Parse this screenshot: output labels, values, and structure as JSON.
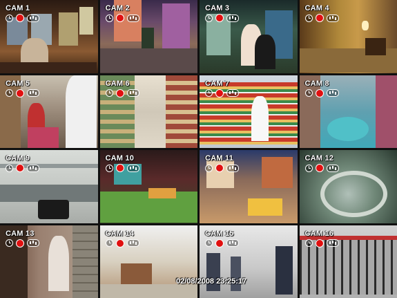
{
  "cameras": [
    {
      "label": "CAM 1"
    },
    {
      "label": "CAM 2"
    },
    {
      "label": "CAM 3"
    },
    {
      "label": "CAM 4"
    },
    {
      "label": "CAM 5"
    },
    {
      "label": "CAM 6"
    },
    {
      "label": "CAM 7"
    },
    {
      "label": "CAM 8"
    },
    {
      "label": "CAM 9"
    },
    {
      "label": "CAM 10"
    },
    {
      "label": "CAM 11"
    },
    {
      "label": "CAM 12"
    },
    {
      "label": "CAM 13"
    },
    {
      "label": "CAM 14"
    },
    {
      "label": "CAM 15"
    },
    {
      "label": "CAM 16"
    }
  ],
  "timestamp": "02/08/2008 23:25:17",
  "icons": [
    "clock-icon",
    "record-icon",
    "audio-icon"
  ],
  "colors": {
    "record": "#e01010",
    "label": "#ffffff"
  }
}
